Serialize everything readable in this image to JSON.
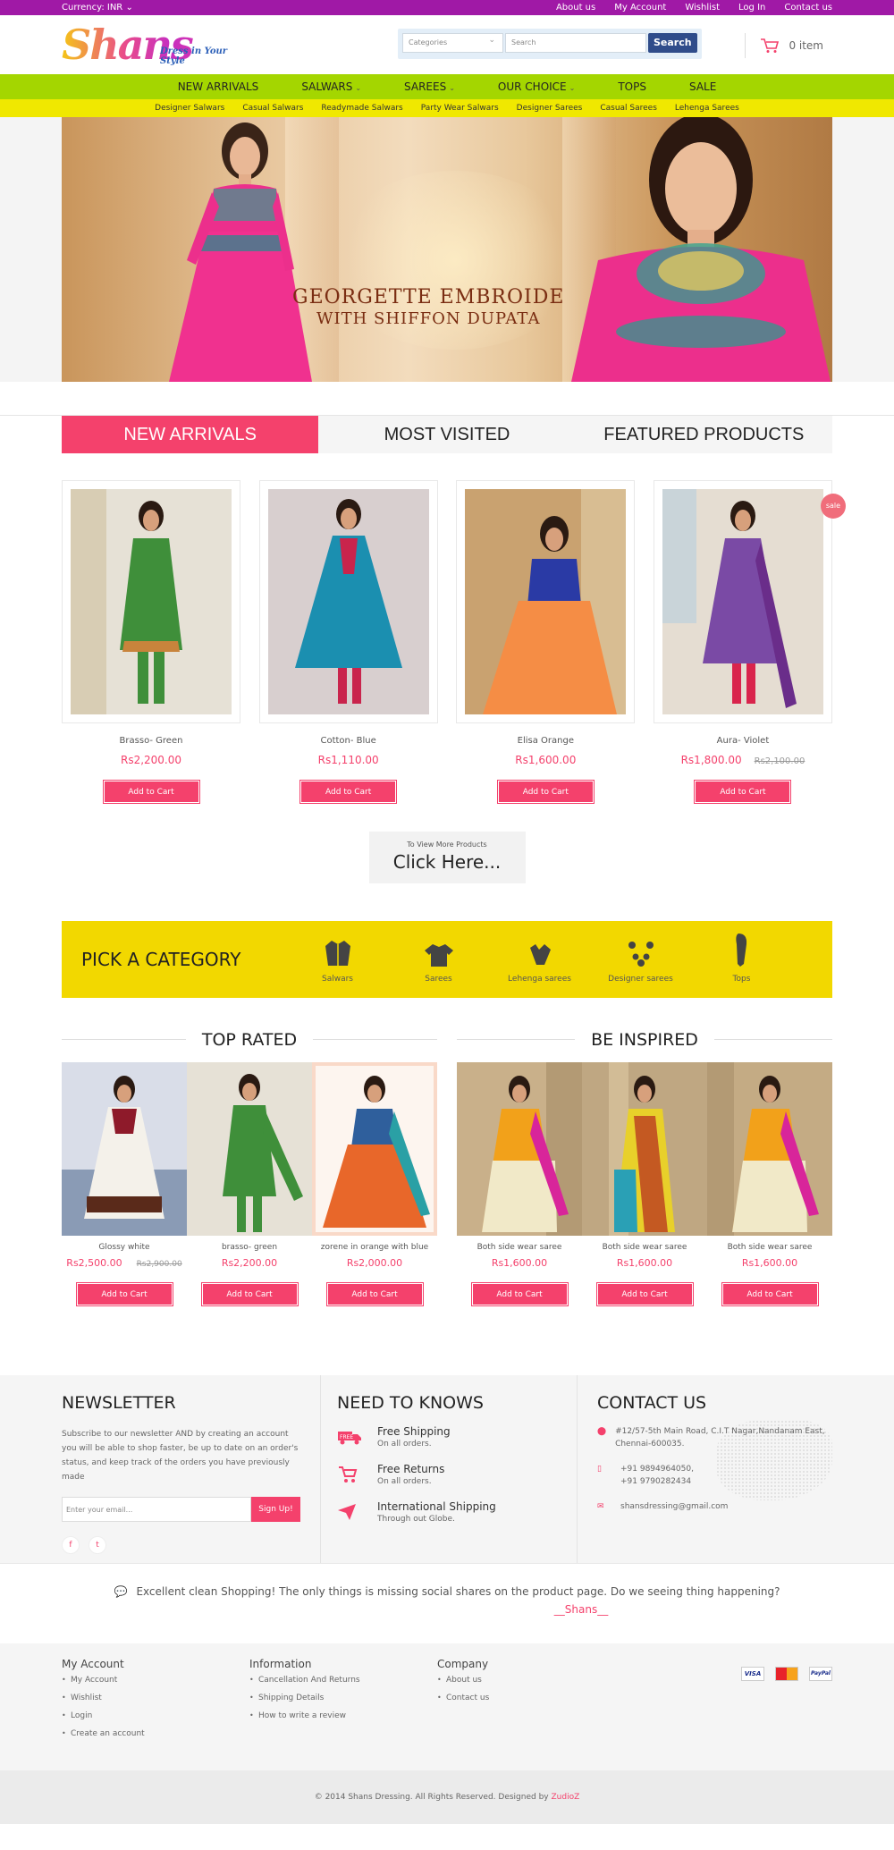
{
  "topbar": {
    "currency": "Currency: INR",
    "links": [
      "About us",
      "My Account",
      "Wishlist",
      "Log In",
      "Contact us"
    ]
  },
  "header": {
    "logo_text": "Shans",
    "tagline": "Dress in Your Style",
    "search": {
      "category": "Categories",
      "placeholder": "Search",
      "button": "Search"
    },
    "cart": "0 item"
  },
  "nav": {
    "items": [
      "NEW ARRIVALS",
      "SALWARS",
      "SAREES",
      "OUR CHOICE",
      "TOPS",
      "SALE"
    ],
    "sub": [
      "Designer Salwars",
      "Casual Salwars",
      "Readymade Salwars",
      "Party Wear Salwars",
      "Designer Sarees",
      "Casual Sarees",
      "Lehenga Sarees"
    ]
  },
  "banner": {
    "line1": "GEORGETTE EMBROIDE",
    "line2": "WITH SHIFFON DUPATA"
  },
  "tabs": [
    "NEW ARRIVALS",
    "MOST VISITED",
    "FEATURED PRODUCTS"
  ],
  "products": [
    {
      "name": "Brasso- Green",
      "price": "Rs2,200.00",
      "old": "",
      "color": "#3f8f3a",
      "bg": "#e6e1d6"
    },
    {
      "name": "Cotton- Blue",
      "price": "Rs1,110.00",
      "old": "",
      "color": "#1b8fb0",
      "bg": "#d8cfcf"
    },
    {
      "name": "Elisa Orange",
      "price": "Rs1,600.00",
      "old": "",
      "color": "#f58d45",
      "bg": "#c9a270"
    },
    {
      "name": "Aura- Violet",
      "price": "Rs1,800.00",
      "old": "Rs2,100.00",
      "color": "#7a4aa5",
      "bg": "#e5ddd2"
    }
  ],
  "add_to_cart": "Add to Cart",
  "sale_badge": "sale",
  "view_more": {
    "small": "To View More Products",
    "big": "Click Here..."
  },
  "pick": {
    "title": "PICK A CATEGORY",
    "cats": [
      "Salwars",
      "Sarees",
      "Lehenga sarees",
      "Designer sarees",
      "Tops"
    ]
  },
  "top_rated": {
    "title": "TOP RATED",
    "items": [
      {
        "name": "Glossy white",
        "price": "Rs2,500.00",
        "old": "Rs2,900.00"
      },
      {
        "name": "brasso- green",
        "price": "Rs2,200.00",
        "old": ""
      },
      {
        "name": "zorene in orange with blue",
        "price": "Rs2,000.00",
        "old": ""
      }
    ]
  },
  "inspired": {
    "title": "BE INSPIRED",
    "items": [
      {
        "name": "Both side wear saree",
        "price": "Rs1,600.00",
        "old": ""
      },
      {
        "name": "Both side wear saree",
        "price": "Rs1,600.00",
        "old": ""
      },
      {
        "name": "Both side wear saree",
        "price": "Rs1,600.00",
        "old": ""
      }
    ]
  },
  "newsletter": {
    "title": "NEWSLETTER",
    "text": "Subscribe to our newsletter AND by creating an account you will be able to shop faster, be up to date on an order's status, and keep track of the orders you have previously made",
    "placeholder": "Enter your email...",
    "button": "Sign Up!",
    "social": [
      "f",
      "t"
    ]
  },
  "need": {
    "title": "NEED TO KNOWS",
    "items": [
      {
        "a": "Free Shipping",
        "b": "On all orders."
      },
      {
        "a": "Free Returns",
        "b": "On all orders."
      },
      {
        "a": "International Shipping",
        "b": "Through out Globe."
      }
    ]
  },
  "contact": {
    "title": "CONTACT US",
    "address": "#12/57-5th Main Road, C.I.T Nagar,Nandanam East, Chennai-600035.",
    "phone1": "+91 9894964050,",
    "phone2": "+91 9790282434",
    "email": "shansdressing@gmail.com"
  },
  "testimonial": {
    "quote": "Excellent clean Shopping! The only things is missing social shares on the product page. Do we seeing thing happening?",
    "by": "__Shans__"
  },
  "footer": {
    "account": {
      "title": "My Account",
      "links": [
        "My Account",
        "Wishlist",
        "Login",
        "Create an account"
      ]
    },
    "info": {
      "title": "Information",
      "links": [
        "Cancellation And Returns",
        "Shipping Details",
        "How to write a review"
      ]
    },
    "company": {
      "title": "Company",
      "links": [
        "About us",
        "Contact us"
      ]
    },
    "pay": [
      "VISA",
      "MC",
      "PayPal"
    ],
    "copyright": "© 2014 Shans Dressing. All Rights Reserved. Designed by",
    "designer": "ZudioZ"
  }
}
